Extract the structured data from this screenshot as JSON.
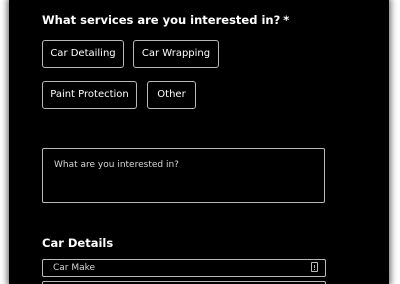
{
  "services": {
    "heading": "What services are you interested in?",
    "required_mark": "*",
    "options": [
      {
        "label": "Car Detailing"
      },
      {
        "label": "Car Wrapping"
      },
      {
        "label": "Paint Protection"
      },
      {
        "label": "Other"
      }
    ]
  },
  "interest": {
    "placeholder": "What are you interested in?"
  },
  "car_details": {
    "heading": "Car Details",
    "make_placeholder": "Car Make",
    "make_icon": "info-card-icon"
  },
  "colors": {
    "background": "#000000",
    "text": "#ffffff",
    "border": "#b9b9b9"
  }
}
